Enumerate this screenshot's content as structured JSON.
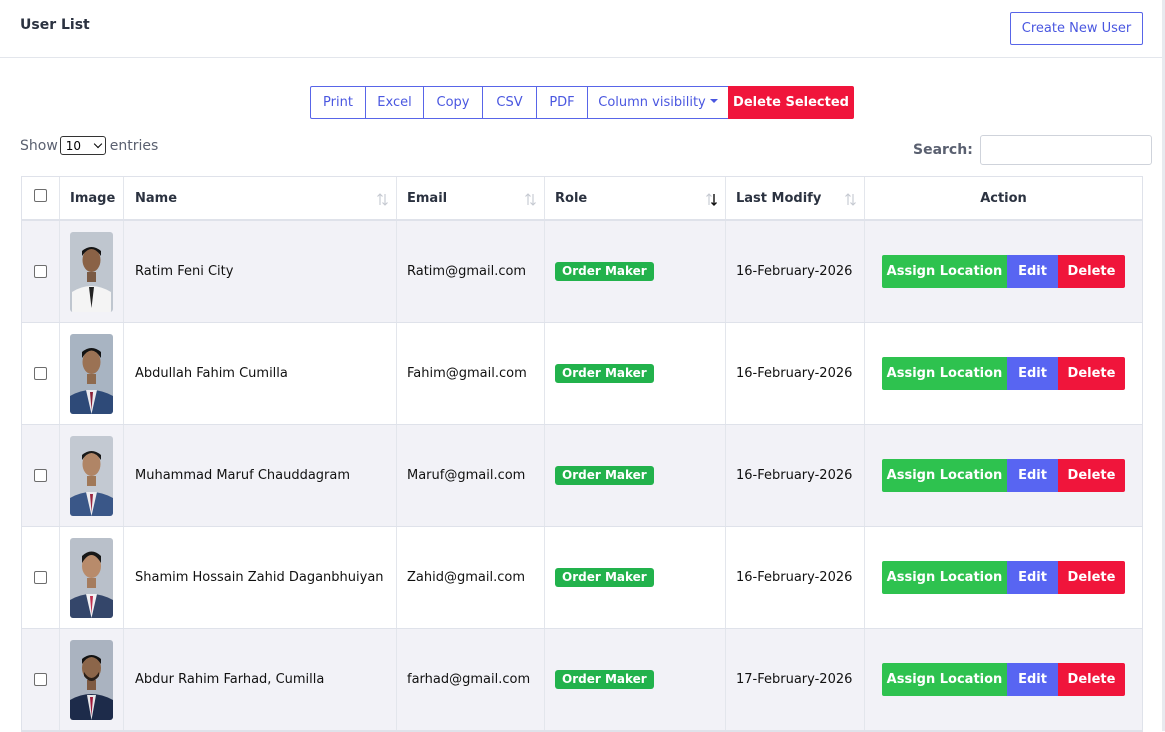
{
  "header": {
    "title": "User List",
    "create_button": "Create New User"
  },
  "toolbar": {
    "buttons": [
      "Print",
      "Excel",
      "Copy",
      "CSV",
      "PDF",
      "Column visibility"
    ],
    "delete_selected": "Delete Selected"
  },
  "length": {
    "show": "Show",
    "value": "10",
    "entries": "entries"
  },
  "search": {
    "label": "Search:",
    "value": ""
  },
  "table": {
    "columns": [
      "Image",
      "Name",
      "Email",
      "Role",
      "Last Modify",
      "Action"
    ],
    "sorted_column": "Role",
    "rows": [
      {
        "name": "Ratim Feni City",
        "email": "Ratim@gmail.com",
        "role": "Order Maker",
        "last_modify": "16-February-2026",
        "assign": "Assign Location",
        "edit": "Edit",
        "delete": "Delete"
      },
      {
        "name": "Abdullah Fahim Cumilla",
        "email": "Fahim@gmail.com",
        "role": "Order Maker",
        "last_modify": "16-February-2026",
        "assign": "Assign Location",
        "edit": "Edit",
        "delete": "Delete"
      },
      {
        "name": "Muhammad Maruf Chauddagram",
        "email": "Maruf@gmail.com",
        "role": "Order Maker",
        "last_modify": "16-February-2026",
        "assign": "Assign Location",
        "edit": "Edit",
        "delete": "Delete"
      },
      {
        "name": "Shamim Hossain Zahid Daganbhuiyan",
        "email": "Zahid@gmail.com",
        "role": "Order Maker",
        "last_modify": "16-February-2026",
        "assign": "Assign Location",
        "edit": "Edit",
        "delete": "Delete"
      },
      {
        "name": "Abdur Rahim Farhad, Cumilla",
        "email": "farhad@gmail.com",
        "role": "Order Maker",
        "last_modify": "17-February-2026",
        "assign": "Assign Location",
        "edit": "Edit",
        "delete": "Delete"
      }
    ]
  },
  "colors": {
    "primary": "#5865e8",
    "success": "#2ec24f",
    "danger": "#f0153b",
    "badge": "#22b24c",
    "row_stripe": "#f2f2f7"
  },
  "icons": [
    "sort-arrows-icon",
    "sort-desc-icon",
    "chevron-down-icon",
    "caret-down-icon",
    "user-photo"
  ]
}
